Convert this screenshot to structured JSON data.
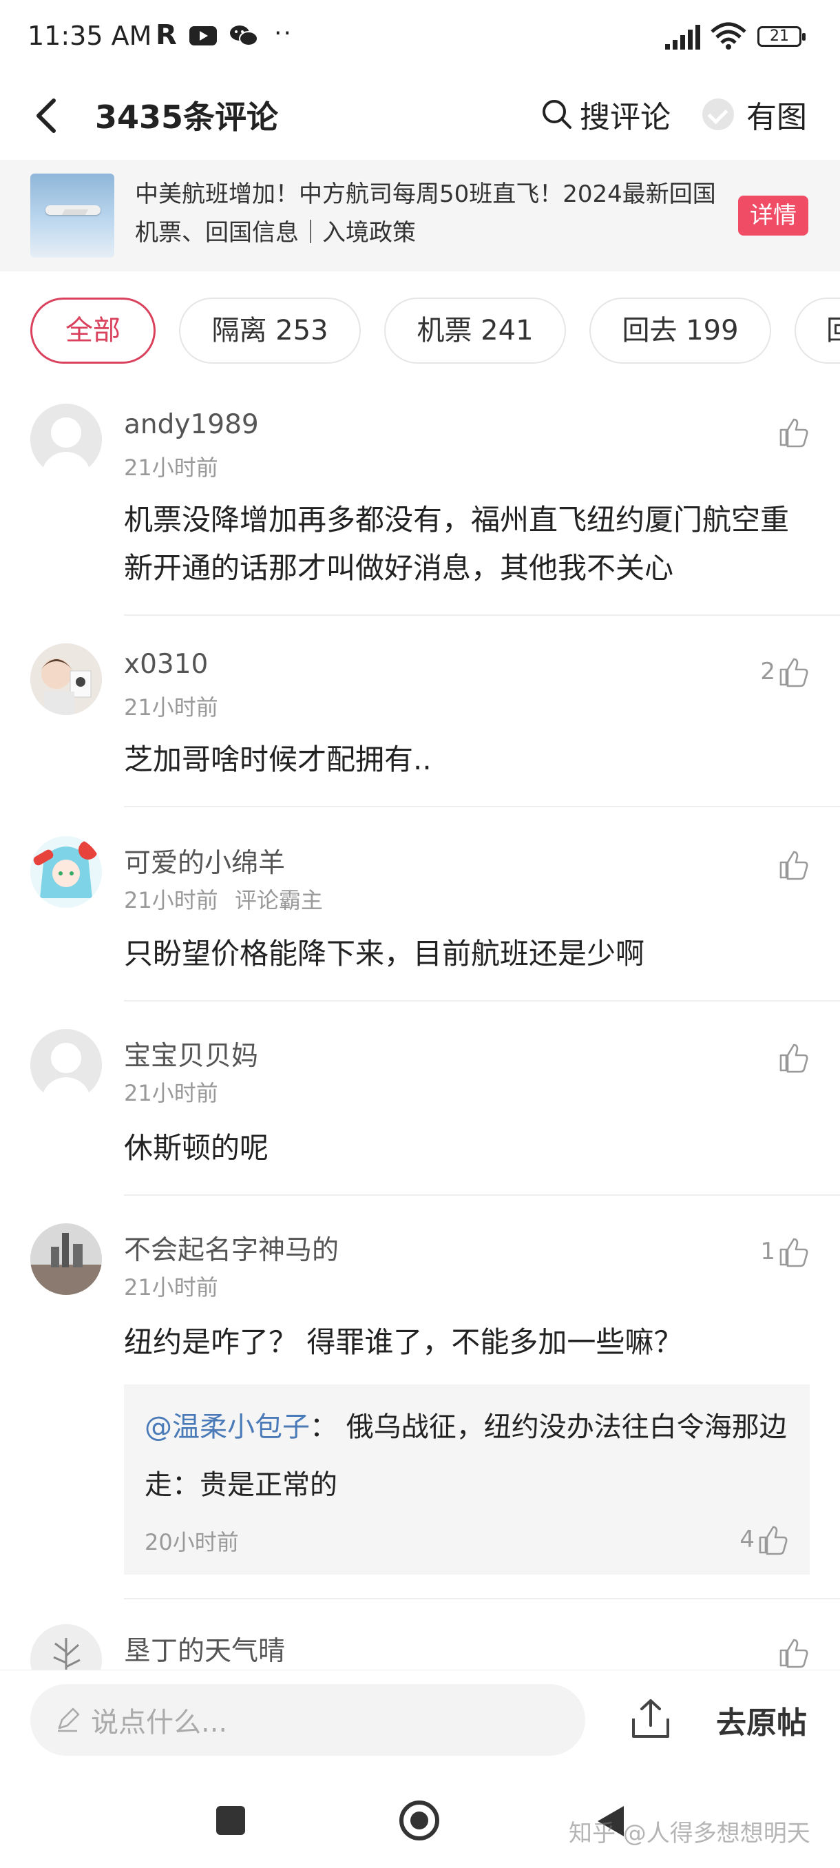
{
  "status_bar": {
    "time": "11:35 AM",
    "r_icon": "R",
    "dots": "··",
    "battery": "21"
  },
  "header": {
    "title": "3435条评论",
    "search_label": "搜评论",
    "with_image_label": "有图"
  },
  "banner": {
    "text": "中美航班增加！中方航司每周50班直飞！2024最新回国机票、回国信息｜入境政策",
    "button_label": "详情"
  },
  "filters": [
    {
      "label": "全部",
      "active": true
    },
    {
      "label": "隔离 253"
    },
    {
      "label": "机票 241"
    },
    {
      "label": "回去 199"
    },
    {
      "label": "回"
    }
  ],
  "comments": [
    {
      "user": "andy1989",
      "time": "21小时前",
      "badge": "",
      "likes": "",
      "text": "机票没降增加再多都没有，福州直飞纽约厦门航空重新开通的话那才叫做好消息，其他我不关心"
    },
    {
      "user": "x0310",
      "time": "21小时前",
      "badge": "",
      "likes": "2",
      "text": "芝加哥啥时候才配拥有.."
    },
    {
      "user": "可爱的小绵羊",
      "time": "21小时前",
      "badge": "评论霸主",
      "likes": "",
      "text": "只盼望价格能降下来，目前航班还是少啊"
    },
    {
      "user": "宝宝贝贝妈",
      "time": "21小时前",
      "badge": "",
      "likes": "",
      "text": "休斯顿的呢"
    },
    {
      "user": "不会起名字神马的",
      "time": "21小时前",
      "badge": "",
      "likes": "1",
      "text": "纽约是咋了？ 得罪谁了，不能多加一些嘛？"
    },
    {
      "user": "垦丁的天气晴",
      "time": "",
      "badge": "",
      "likes": "",
      "text": ""
    }
  ],
  "reply": {
    "mention": "@温柔小包子",
    "text": "：  俄乌战征，纽约没办法往白令海那边走：贵是正常的",
    "time": "20小时前",
    "likes": "4"
  },
  "bottom_bar": {
    "input_placeholder": "说点什么...",
    "goto_label": "去原帖"
  },
  "watermark": "知乎 @人得多想想明天",
  "colors": {
    "accent": "#d9415c",
    "banner_button": "#f04c66",
    "mention": "#4a7ab8"
  }
}
